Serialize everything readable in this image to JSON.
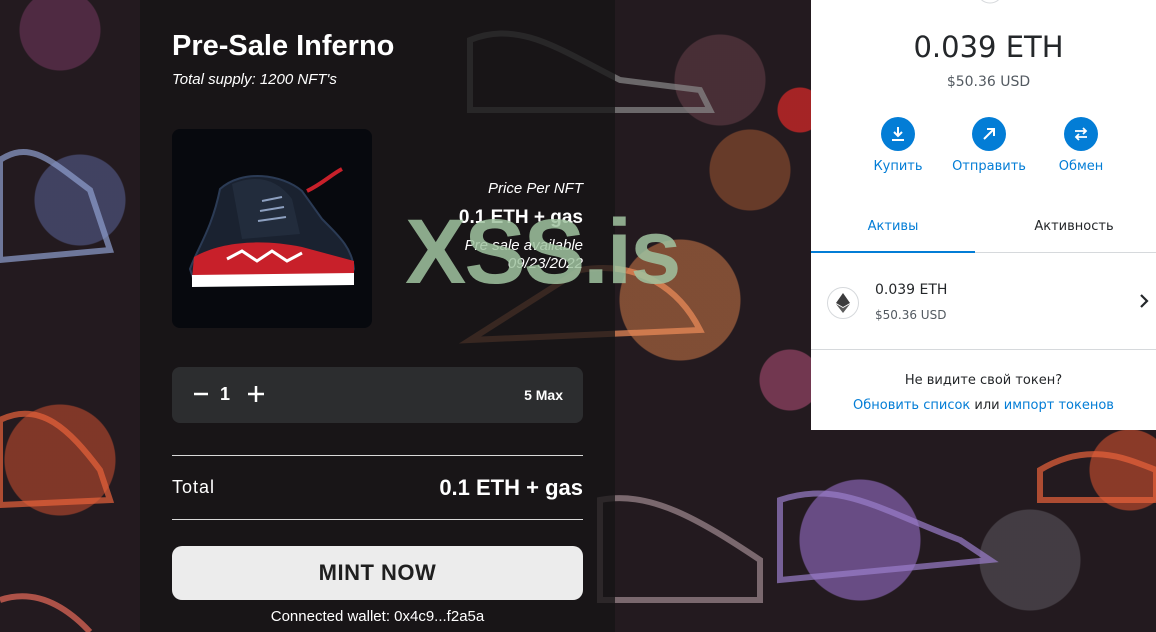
{
  "mint": {
    "title": "Pre-Sale Inferno",
    "subtitle": "Total supply: 1200 NFT's",
    "price_label": "Price Per NFT",
    "price_value": "0.1 ETH + gas",
    "presale_line1": "Pre sale available",
    "presale_date": "09/23/2022",
    "quantity": "1",
    "max_label": "5 Max",
    "total_label": "Total",
    "total_value": "0.1 ETH + gas",
    "mint_button": "MINT NOW",
    "connected_wallet": "Connected wallet: 0x4c9...f2a5a"
  },
  "watermark": "XSS.is",
  "wallet": {
    "balance": "0.039 ETH",
    "balance_usd": "$50.36 USD",
    "actions": [
      {
        "label": "Купить",
        "icon": "download-icon"
      },
      {
        "label": "Отправить",
        "icon": "arrow-up-right-icon"
      },
      {
        "label": "Обмен",
        "icon": "swap-icon"
      }
    ],
    "tabs": [
      {
        "label": "Активы",
        "active": true
      },
      {
        "label": "Активность",
        "active": false
      }
    ],
    "asset": {
      "amount": "0.039 ETH",
      "usd": "$50.36 USD",
      "icon": "ethereum-icon"
    },
    "hint": "Не видите свой токен?",
    "refresh_link": "Обновить список",
    "or_text": "или",
    "import_link": "импорт токенов"
  },
  "colors": {
    "accent": "#037dd6",
    "panel_bg": "#161416",
    "background": "#231a1f",
    "watermark": "#a0c3a0"
  }
}
